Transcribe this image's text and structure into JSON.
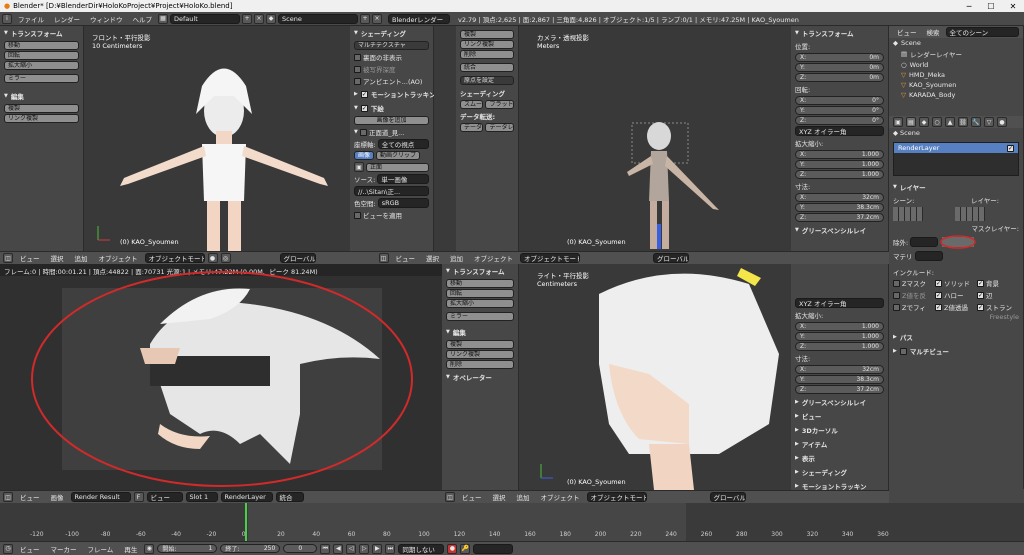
{
  "window": {
    "title": "Blender* [D:¥BlenderDir¥HoloKoProject¥Project¥HoloKo.blend]"
  },
  "menu": {
    "items": [
      "ファイル",
      "レンダー",
      "ウィンドウ",
      "ヘルプ"
    ],
    "layout": "Default",
    "scene": "Scene",
    "engine": "Blenderレンダー",
    "stats": "v2.79 | 頂点:2,625 | 面:2,867 | 三角面:4,826 | オブジェクト:1/5 | ランプ:0/1 | メモリ:47.25M | KAO_Syoumen"
  },
  "tool_left": {
    "transform_header": "トランスフォーム",
    "transform_buttons": [
      "移動",
      "回転",
      "拡大縮小"
    ],
    "mirror": "ミラー",
    "edit_header": "編集",
    "edit_buttons": [
      "複製",
      "リンク複製"
    ]
  },
  "vp_front": {
    "label1": "フロント・平行投影",
    "label2": "10 Centimeters",
    "object": "(0) KAO_Syoumen"
  },
  "props_panel": {
    "shading_header": "シェーディング",
    "matcap": "マルチテクスチャ",
    "backface": "裏面の非表示",
    "depth": "被写界深度",
    "ao": "アンビエント...(AO)",
    "motion_tracking": "モーショントラッキン",
    "background": "下絵",
    "add_image": "画像を追加",
    "image_name": "正面道_見...",
    "axis_label": "座標軸:",
    "axis_value": "全ての視点",
    "tab_image": "画像",
    "tab_movie": "動画クリップ",
    "source_label": "ソース:",
    "source_value": "単一画像",
    "file_path": "//..\\Sitan\\正...",
    "colorspace_label": "色空間:",
    "colorspace_value": "sRGB",
    "view_apply": "ビューを適用"
  },
  "tool_mid": {
    "buttons": [
      "複製",
      "リンク複製",
      "削除",
      "統合"
    ],
    "origin": "原点を設定",
    "shading": "シェーディング",
    "smooth": "スムー",
    "flat": "フラット",
    "data_transfer": "データ転送:",
    "data": "データ",
    "data_layers": "データレ"
  },
  "vp_camera": {
    "label1": "カメラ・透視投影",
    "label2": "Meters",
    "object": "(0) KAO_Syoumen"
  },
  "npanel_top": {
    "transform": "トランスフォーム",
    "location": "位置:",
    "loc": [
      {
        "axis": "X:",
        "val": "0m"
      },
      {
        "axis": "Y:",
        "val": "0m"
      },
      {
        "axis": "Z:",
        "val": "0m"
      }
    ],
    "rotation": "回転:",
    "rot": [
      {
        "axis": "X:",
        "val": "0°"
      },
      {
        "axis": "Y:",
        "val": "0°"
      },
      {
        "axis": "Z:",
        "val": "0°"
      }
    ],
    "rot_mode": "XYZ オイラー角",
    "scale": "拡大縮小:",
    "scl": [
      {
        "axis": "X:",
        "val": "1.000"
      },
      {
        "axis": "Y:",
        "val": "1.000"
      },
      {
        "axis": "Z:",
        "val": "1.000"
      }
    ],
    "dims": "寸法:",
    "dim": [
      {
        "axis": "X:",
        "val": "32cm"
      },
      {
        "axis": "Y:",
        "val": "38.3cm"
      },
      {
        "axis": "Z:",
        "val": "37.2cm"
      }
    ],
    "grease": "グリースペンシルレイ"
  },
  "header_top": {
    "view": "ビュー",
    "select": "選択",
    "add": "追加",
    "object": "オブジェクト",
    "mode": "オブジェクトモード",
    "pivot": "グローバル"
  },
  "outliner": {
    "tabs": [
      "ビュー",
      "検索",
      "全てのシーン"
    ],
    "items": [
      "Scene",
      "レンダーレイヤー",
      "World",
      "HMD_Meka",
      "KAO_Syoumen",
      "KARADA_Body"
    ]
  },
  "render_props": {
    "scene": "Scene",
    "layer_name": "RenderLayer",
    "layer_header": "レイヤー",
    "scene_label": "シーン:",
    "layer_label": "レイヤー:",
    "mask_label": "マスクレイヤー:",
    "exclude": "除外:",
    "material": "マテリ",
    "include_header": "インクルード:",
    "opts": [
      {
        "label": "Zマスク",
        "on": false
      },
      {
        "label": "ソリッド",
        "on": true
      },
      {
        "label": "背景",
        "on": true
      },
      {
        "label": "Z値を反",
        "on": false
      },
      {
        "label": "ハロー",
        "on": true
      },
      {
        "label": "辺",
        "on": true
      },
      {
        "label": "Zでフィ",
        "on": false
      },
      {
        "label": "Z値透過",
        "on": true
      },
      {
        "label": "ストラン",
        "on": true
      }
    ],
    "freestyle": "Freestyle",
    "passes": "パス",
    "multiview": "マルチビュー"
  },
  "render": {
    "info": "フレーム:0 | 時間:00:01.21 | 頂点:44822 | 面:70731 光源:1 | メモリ:47.22M (0.00M、ピーク 81.24M)",
    "header": {
      "view": "ビュー",
      "image": "画像",
      "render": "Render Result",
      "f": "F",
      "view2": "ビュー",
      "slot": "Slot 1",
      "layer": "RenderLayer",
      "composite": "統合"
    }
  },
  "vp_right": {
    "label1": "ライト・平行投影",
    "label2": "Centimeters",
    "object": "(0) KAO_Syoumen"
  },
  "npanel_bottom": {
    "rot_mode": "XYZ オイラー角",
    "scale": "拡大縮小:",
    "scl": [
      {
        "axis": "X:",
        "val": "1.000"
      },
      {
        "axis": "Y:",
        "val": "1.000"
      },
      {
        "axis": "Z:",
        "val": "1.000"
      }
    ],
    "dims": "寸法:",
    "dim": [
      {
        "axis": "X:",
        "val": "32cm"
      },
      {
        "axis": "Y:",
        "val": "38.3cm"
      },
      {
        "axis": "Z:",
        "val": "37.2cm"
      }
    ],
    "sections": [
      "グリースペンシルレイ",
      "ビュー",
      "3Dカーソル",
      "アイテム",
      "表示",
      "シェーディング",
      "モーショントラッキン"
    ]
  },
  "tool_mid2": {
    "transform": "トランスフォーム",
    "buttons": [
      "移動",
      "回転",
      "拡大縮小"
    ],
    "mirror": "ミラー",
    "edit": "編集",
    "edit_buttons": [
      "複製",
      "リンク複製",
      "削除"
    ],
    "operator": "オペレーター"
  },
  "timeline": {
    "ticks": [
      "-120",
      "-100",
      "-80",
      "-60",
      "-40",
      "-20",
      "0",
      "20",
      "40",
      "60",
      "80",
      "100",
      "120",
      "140",
      "160",
      "180",
      "200",
      "220",
      "240",
      "260",
      "280",
      "300",
      "320",
      "340",
      "360"
    ],
    "menu": [
      "ビュー",
      "マーカー",
      "フレーム",
      "再生"
    ],
    "start_label": "開始:",
    "start": "1",
    "end_label": "終了:",
    "end": "250",
    "current": "0",
    "sync": "同期しない"
  },
  "colors": {
    "accent": "#5680c2",
    "annotation": "#d12a2a",
    "background": "#393939",
    "panel": "#474747"
  }
}
